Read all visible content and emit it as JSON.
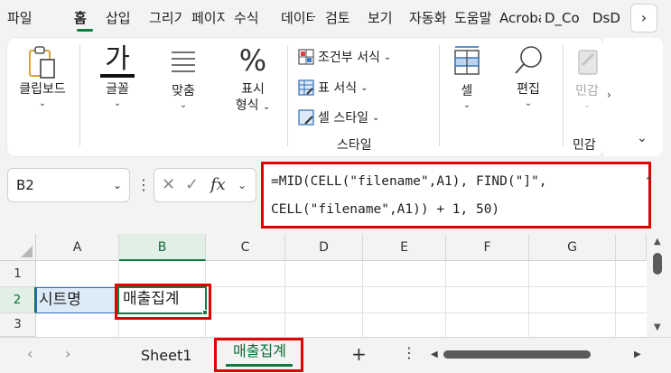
{
  "ribbon_tabs": [
    {
      "label": "파일"
    },
    {
      "label": "홈"
    },
    {
      "label": "삽입"
    },
    {
      "label": "그리기"
    },
    {
      "label": "페이지 레이아웃"
    },
    {
      "label": "수식"
    },
    {
      "label": "데이터"
    },
    {
      "label": "검토"
    },
    {
      "label": "보기"
    },
    {
      "label": "자동화"
    },
    {
      "label": "도움말"
    },
    {
      "label": "Acrobat"
    },
    {
      "label": "D_Co"
    },
    {
      "label": "DsD"
    }
  ],
  "ribbon_more": "›",
  "groups": {
    "clipboard": "클립보드",
    "font": "글꼴",
    "font_glyph": "가",
    "alignment": "맞춤",
    "number_line1": "표시",
    "number_line2": "형식",
    "number_glyph": "%",
    "conditional_format": "조건부 서식",
    "table_format": "표 서식",
    "cell_style": "셀 스타일",
    "styles_title": "스타일",
    "cells": "셀",
    "editing": "편집",
    "sensitivity": "민감",
    "sensitivity_group": "민감"
  },
  "formula_bar": {
    "name_box": "B2",
    "fx_label": "fx",
    "formula_line1": "=MID(CELL(\"filename\",A1), FIND(\"]\",",
    "formula_line2": "CELL(\"filename\",A1)) + 1, 50)"
  },
  "grid": {
    "columns": [
      "A",
      "B",
      "C",
      "D",
      "E",
      "F",
      "G"
    ],
    "rows": [
      "1",
      "2",
      "3"
    ],
    "cells": {
      "A2": "시트명",
      "B2": "매출집계"
    }
  },
  "sheet_tabs": {
    "tabs": [
      "Sheet1",
      "매출집계"
    ],
    "active": "매출집계",
    "add_label": "+",
    "more_label": "⋮"
  },
  "colors": {
    "excel_green": "#107c41",
    "highlight_red": "#e00000",
    "cell_blue": "#ddebf7"
  }
}
